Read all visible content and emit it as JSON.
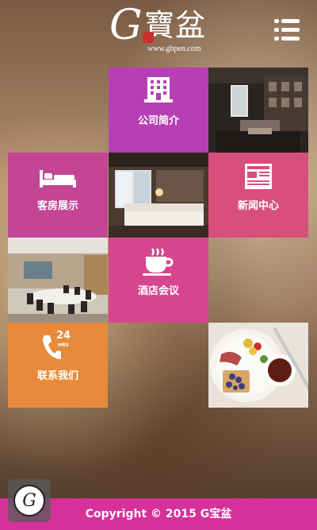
{
  "header": {
    "logo_letter": "G",
    "logo_text": "寶盆",
    "logo_url": "www.gbpen.com",
    "menu_icon": "hamburger-menu-icon"
  },
  "tiles": {
    "about": {
      "label": "公司简介",
      "icon": "building-icon",
      "color": "#b63fb5"
    },
    "rooms": {
      "label": "客房展示",
      "icon": "bed-icon",
      "color": "#c44596"
    },
    "news": {
      "label": "新闻中心",
      "icon": "newspaper-icon",
      "color": "#d94f7b"
    },
    "meeting": {
      "label": "酒店会议",
      "icon": "coffee-cup-icon",
      "color": "#d5468e"
    },
    "contact": {
      "label": "联系我们",
      "icon": "phone-24hrs-icon",
      "color": "#e88a3b",
      "icon_number": "24",
      "icon_unit": "HRS"
    }
  },
  "photos": [
    "lounge-photo",
    "hotel-room-photo",
    "conference-room-photo",
    "breakfast-photo"
  ],
  "footer": {
    "copyright": "Copyright © 2015 G宝盆"
  },
  "fab": {
    "icon": "g-logo-icon",
    "letter": "G"
  }
}
